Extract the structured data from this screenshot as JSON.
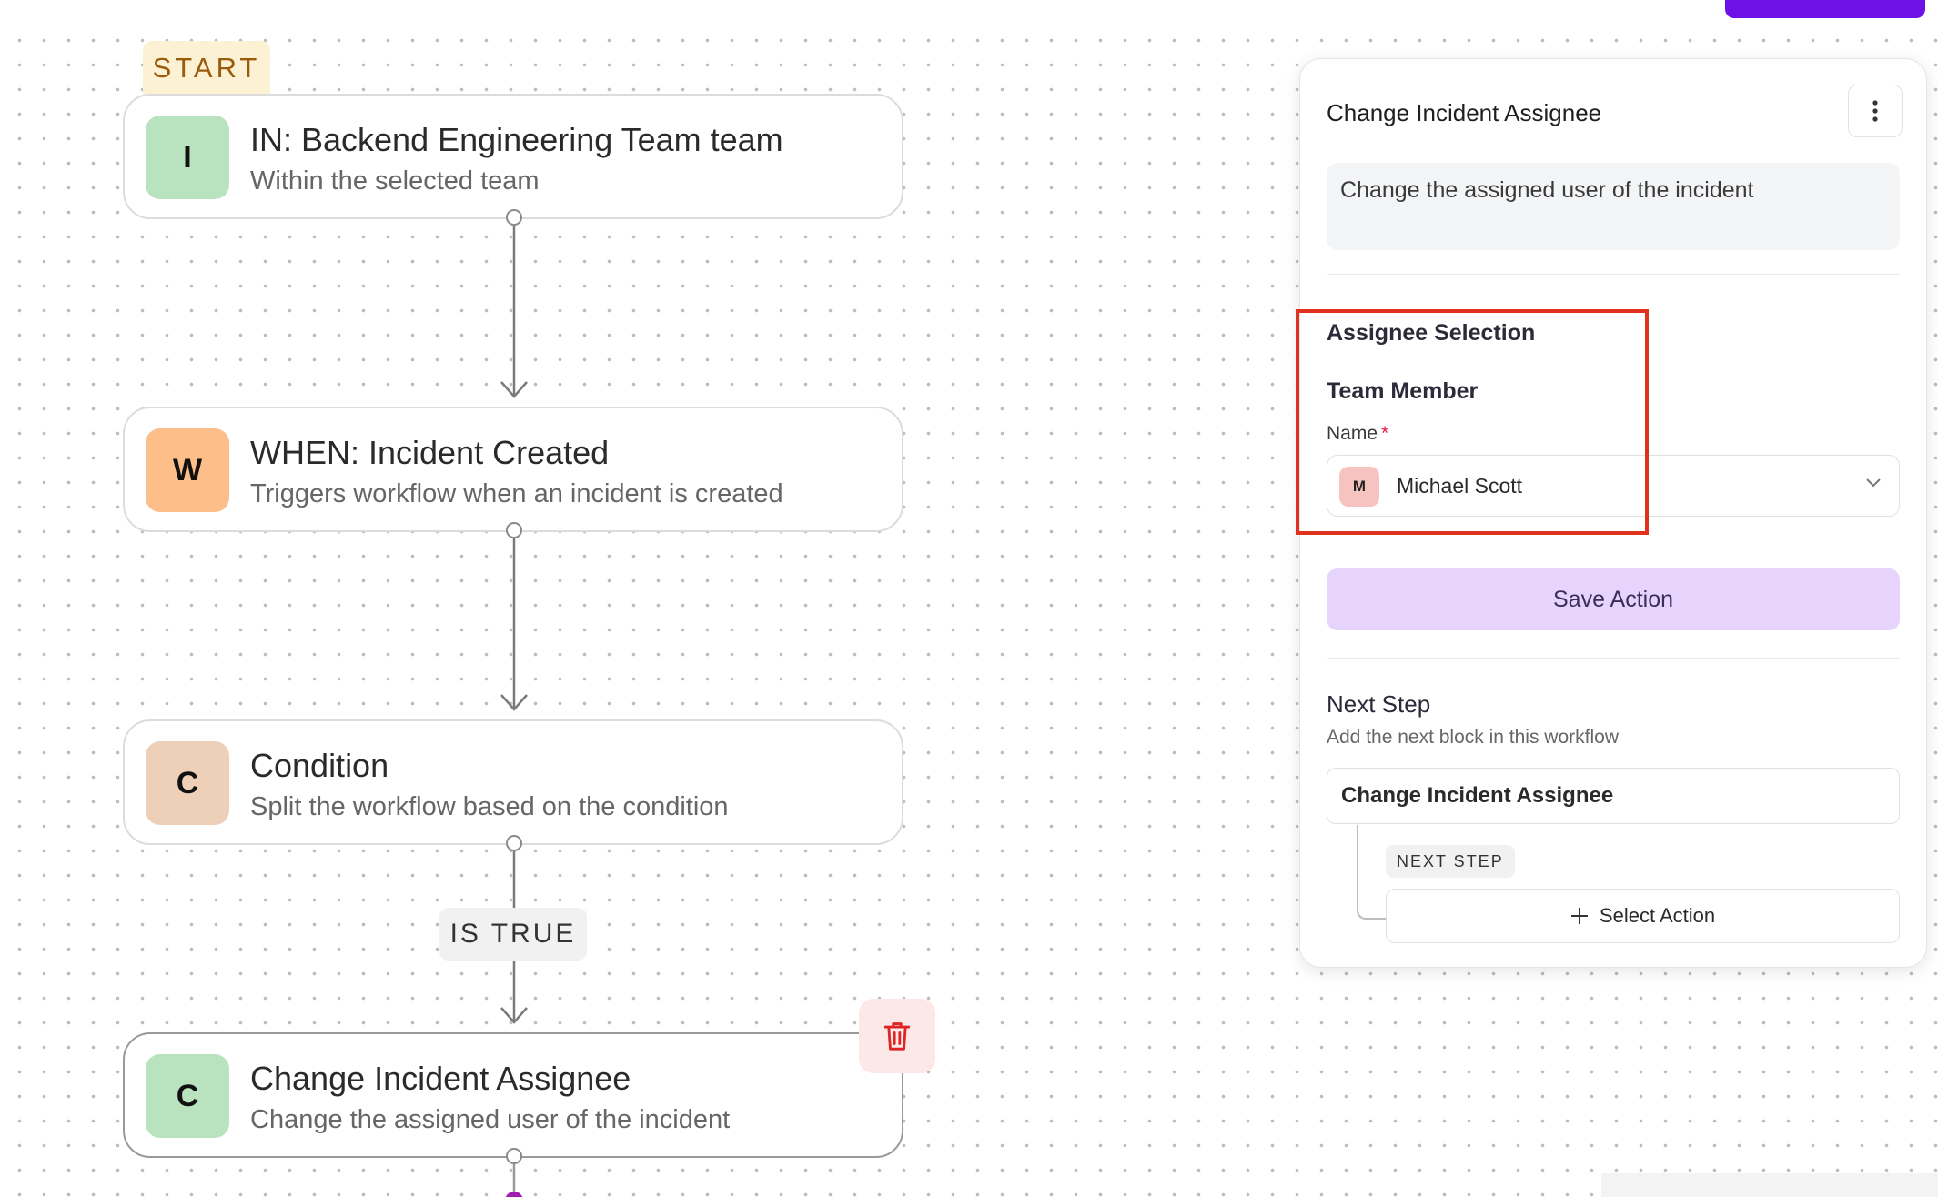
{
  "start_label": "START",
  "nodes": [
    {
      "letter": "I",
      "title": "IN: Backend Engineering Team team",
      "subtitle": "Within the selected team",
      "color": "#b9e2bf"
    },
    {
      "letter": "W",
      "title": "WHEN: Incident Created",
      "subtitle": "Triggers workflow when an incident is created",
      "color": "#fdbe8a"
    },
    {
      "letter": "C",
      "title": "Condition",
      "subtitle": "Split the workflow based on the condition",
      "color": "#edd0b7"
    },
    {
      "letter": "C",
      "title": "Change Incident Assignee",
      "subtitle": "Change the assigned user of the incident",
      "color": "#b9e2bf"
    }
  ],
  "condition_label": "IS TRUE",
  "panel": {
    "title": "Change Incident Assignee",
    "description": "Change the assigned user of the incident",
    "section_heading": "Assignee Selection",
    "subsection_heading": "Team Member",
    "field_label": "Name",
    "required_mark": "*",
    "selected_user": {
      "initial": "M",
      "name": "Michael Scott"
    },
    "save_label": "Save Action",
    "next_step_heading": "Next Step",
    "next_step_sub": "Add the next block in this workflow",
    "next_block": "Change Incident Assignee",
    "next_badge": "NEXT STEP",
    "select_action_label": "Select Action"
  },
  "colors": {
    "accent": "#6d11e6",
    "save_button": "#e6d4fd",
    "highlight": "#e0301e",
    "danger": "#dc2626"
  }
}
